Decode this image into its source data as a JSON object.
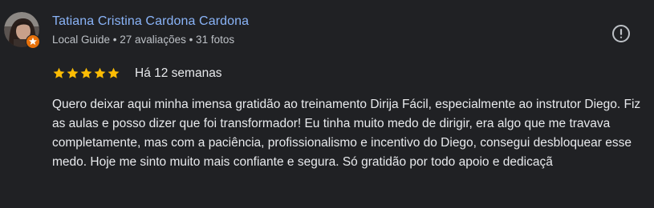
{
  "review": {
    "author_name": "Tatiana Cristina Cardona Cardona",
    "author_meta": "Local Guide • 27 avaliações • 31 fotos",
    "rating": 5,
    "rating_max": 5,
    "time_ago": "Há 12 semanas",
    "text": "Quero deixar aqui minha imensa gratidão ao treinamento Dirija Fácil, especialmente ao instrutor Diego. Fiz as aulas e posso dizer que foi transformador! Eu tinha muito medo de dirigir, era algo que me travava completamente, mas com a paciência, profissionalismo e incentivo do Diego, consegui desbloquear esse medo. Hoje me sinto muito mais confiante e segura. Só gratidão por todo apoio e dedicaçã"
  },
  "icons": {
    "report": "exclamation-circle-icon",
    "star": "star-icon",
    "local_guide_badge": "local-guide-badge-icon"
  },
  "colors": {
    "background": "#202124",
    "name_link": "#8ab4f8",
    "star_fill": "#fbbc04",
    "badge": "#e8710a"
  }
}
